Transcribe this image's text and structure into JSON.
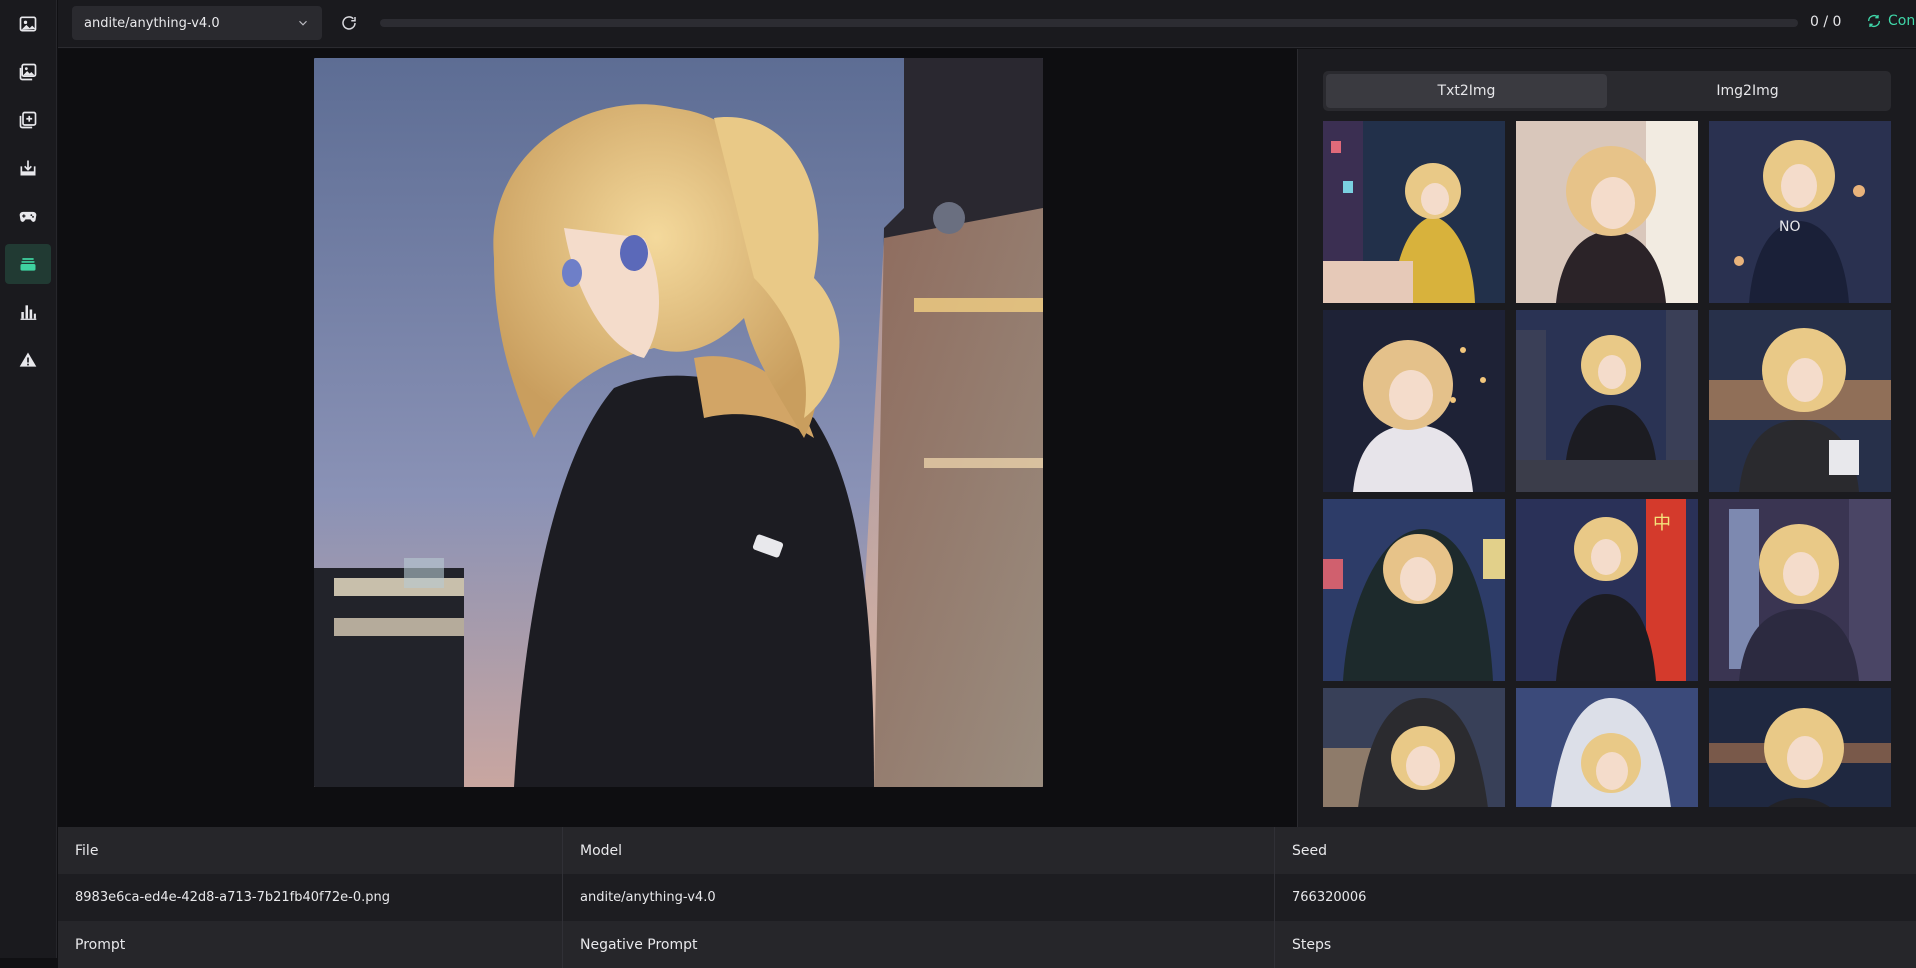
{
  "sidebar": {
    "items": [
      {
        "icon": "image-icon"
      },
      {
        "icon": "images-icon"
      },
      {
        "icon": "add-image-icon"
      },
      {
        "icon": "download-icon"
      },
      {
        "icon": "gamepad-icon"
      },
      {
        "icon": "layers-icon",
        "active": true
      },
      {
        "icon": "bar-chart-icon"
      },
      {
        "icon": "warning-icon"
      }
    ],
    "accent_color": "#3fd2a0"
  },
  "topbar": {
    "model_select_value": "andite/anything-v4.0",
    "progress_value": 0,
    "progress_text": "0 / 0",
    "status_text": "Connected",
    "status_color": "#3fd6a8"
  },
  "gallery": {
    "tabs": [
      {
        "label": "Txt2Img",
        "active": true
      },
      {
        "label": "Img2Img",
        "active": false
      }
    ],
    "thumbnail_count": 12
  },
  "info_table": {
    "headers": [
      "File",
      "Model",
      "Seed"
    ],
    "values": [
      "8983e6ca-ed4e-42d8-a713-7b21fb40f72e-0.png",
      "andite/anything-v4.0",
      "766320006"
    ],
    "headers2": [
      "Prompt",
      "Negative Prompt",
      "Steps"
    ]
  }
}
